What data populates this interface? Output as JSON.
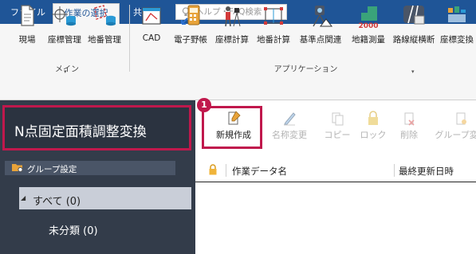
{
  "tabs": [
    {
      "label": "ファイル"
    },
    {
      "label": "作業の選択"
    },
    {
      "label": "共通"
    }
  ],
  "search": {
    "placeholder": "ヘルプ・FAQ検索"
  },
  "ribbon": {
    "main_group": {
      "label": "メイン",
      "buttons": [
        {
          "label": "現場"
        },
        {
          "label": "座標管理"
        },
        {
          "label": "地番管理"
        }
      ]
    },
    "app_group": {
      "label": "アプリケーション",
      "buttons": [
        {
          "label": "CAD"
        },
        {
          "label": "電子野帳"
        },
        {
          "label": "座標計算"
        },
        {
          "label": "地番計算"
        },
        {
          "label": "基準点関連"
        },
        {
          "label": "地籍測量",
          "icon_text": "2000"
        },
        {
          "label": "路線縦横断"
        },
        {
          "label": "座標変換"
        }
      ]
    }
  },
  "left_panel": {
    "title": "N点固定面積調整変換",
    "group_header": "グループ設定",
    "tree": [
      {
        "label": "すべて (0)"
      },
      {
        "label": "未分類 (0)"
      }
    ]
  },
  "toolbar": {
    "badge": "1",
    "buttons": [
      {
        "label": "新規作成"
      },
      {
        "label": "名称変更"
      },
      {
        "label": "コピー"
      },
      {
        "label": "ロック"
      },
      {
        "label": "削除"
      },
      {
        "label": "グループ変更"
      }
    ]
  },
  "list": {
    "columns": [
      "作業データ名",
      "最終更新日時"
    ]
  },
  "colors": {
    "tab_bar": "#1f5597",
    "left_panel": "#333c4a",
    "highlight": "#c0184c",
    "ribbon": "#f6f6f6"
  }
}
